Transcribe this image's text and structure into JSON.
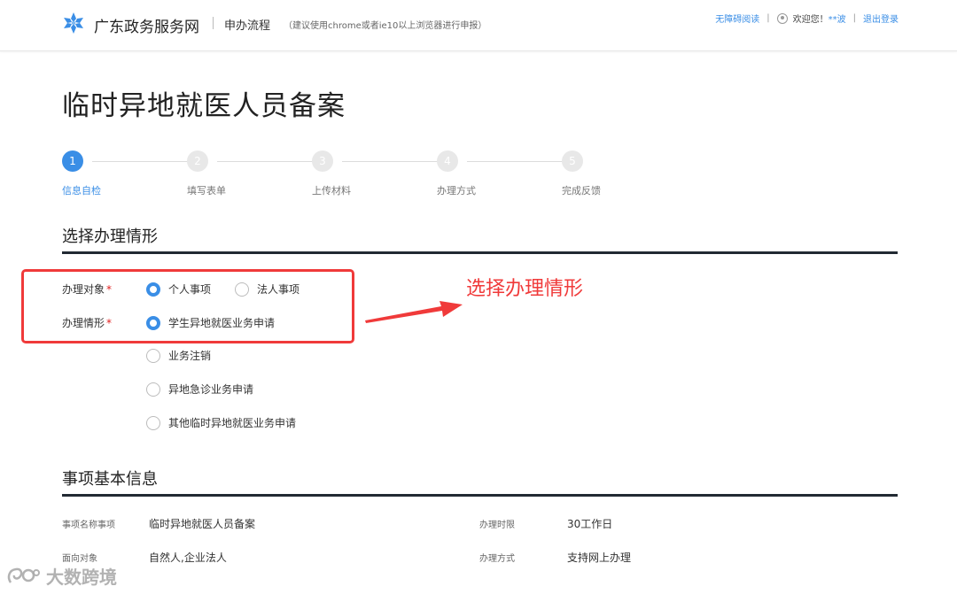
{
  "header": {
    "site_name": "广东政务服务网",
    "process_label": "申办流程",
    "browser_hint": "（建议使用chrome或者ie10以上浏览器进行申报）",
    "accessible_reading": "无障碍阅读",
    "welcome": "欢迎您！",
    "username": "**波",
    "logout": "退出登录",
    "logo_icon": "snowflake-logo-icon",
    "user_icon": "user-icon"
  },
  "page_title": "临时异地就医人员备案",
  "steps": [
    {
      "num": "1",
      "label": "信息自检",
      "active": true
    },
    {
      "num": "2",
      "label": "填写表单",
      "active": false
    },
    {
      "num": "3",
      "label": "上传材料",
      "active": false
    },
    {
      "num": "4",
      "label": "办理方式",
      "active": false
    },
    {
      "num": "5",
      "label": "完成反馈",
      "active": false
    }
  ],
  "section1": {
    "title": "选择办理情形",
    "object_label": "办理对象",
    "situation_label": "办理情形",
    "required_mark": "*",
    "object_options": [
      "个人事项",
      "法人事项"
    ],
    "object_selected": "个人事项",
    "situation_options": [
      "学生异地就医业务申请",
      "业务注销",
      "异地急诊业务申请",
      "其他临时异地就医业务申请"
    ],
    "situation_selected": "学生异地就医业务申请"
  },
  "annotation": {
    "text": "选择办理情形",
    "color": "#f03a3a"
  },
  "section2": {
    "title": "事项基本信息",
    "rows": [
      {
        "label": "事项名称事项",
        "value": "临时异地就医人员备案",
        "label2": "办理时限",
        "value2": "30工作日"
      },
      {
        "label": "面向对象",
        "value": "自然人,企业法人",
        "label2": "办理方式",
        "value2": "支持网上办理"
      }
    ]
  },
  "watermark": {
    "text": "大数跨境"
  },
  "colors": {
    "accent": "#3a8ee6",
    "rule": "#222a33",
    "required": "#e02020"
  }
}
